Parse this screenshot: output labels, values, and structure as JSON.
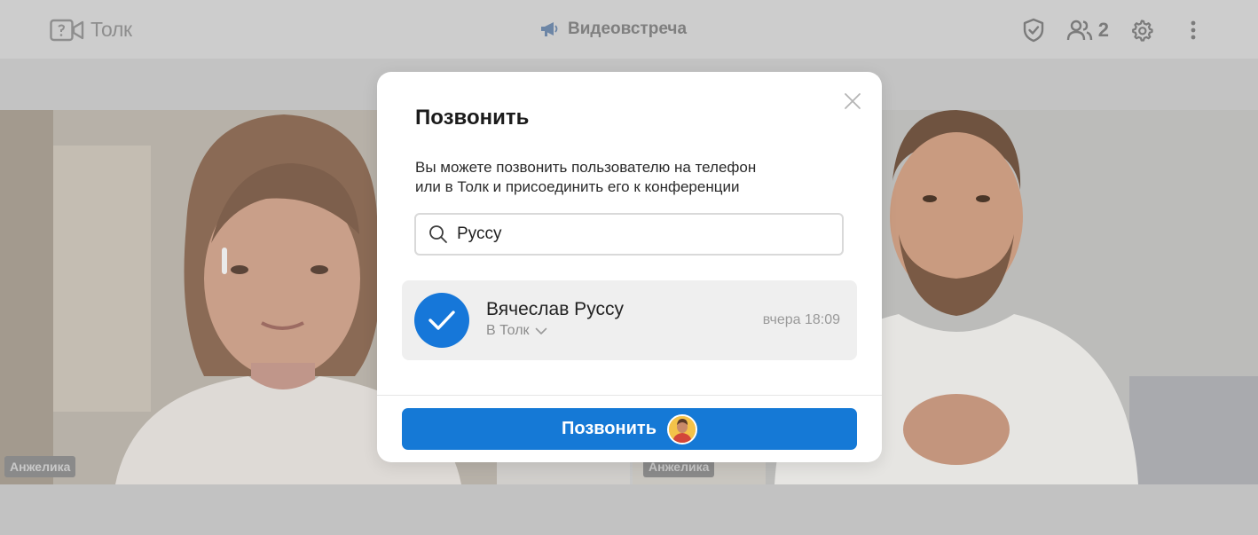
{
  "app": {
    "logo_text": "Толк",
    "meeting_title": "Видеовстреча",
    "participants_count": "2"
  },
  "tiles": [
    {
      "name": "Анжелика"
    },
    {
      "name": "Анжелика"
    }
  ],
  "dialog": {
    "title": "Позвонить",
    "description": "Вы можете позвонить пользователю на телефон\nили в Толк и присоединить его к конференции",
    "search_value": "Руссу",
    "result": {
      "name": "Вячеслав Руссу",
      "channel": "В Толк",
      "time": "вчера 18:09",
      "selected": true
    },
    "call_button_label": "Позвонить"
  },
  "colors": {
    "accent": "#1579d6",
    "avatar_bg": "#f3c24a"
  }
}
